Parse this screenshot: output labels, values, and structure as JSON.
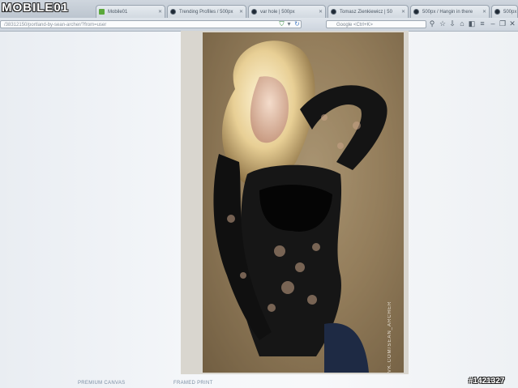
{
  "overlay": {
    "logo": "MOBILE01",
    "stamp": "#1421327"
  },
  "browser": {
    "tabs": [
      {
        "label": "Mobile01",
        "icon": "mobile01-icon"
      },
      {
        "label": "Trending Profiles / 500px",
        "icon": "500px-icon"
      },
      {
        "label": "var hole | 500px",
        "icon": "500px-icon"
      },
      {
        "label": "Tomasz Zienkiewicz | 50",
        "icon": "500px-icon"
      },
      {
        "label": "500px / Hangin in there",
        "icon": "500px-icon"
      },
      {
        "label": "500px",
        "icon": "500px-icon"
      }
    ],
    "url": "/38312150/portland-by-sean-archer/?from=user",
    "search_placeholder": "Google <Ctrl+K>"
  },
  "photo": {
    "watermark": "VK.COM/SEAN_ARCHER"
  },
  "page_links": {
    "premium_canvas": "PREMIUM CANVAS",
    "framed_print": "FRAMED PRINT"
  }
}
